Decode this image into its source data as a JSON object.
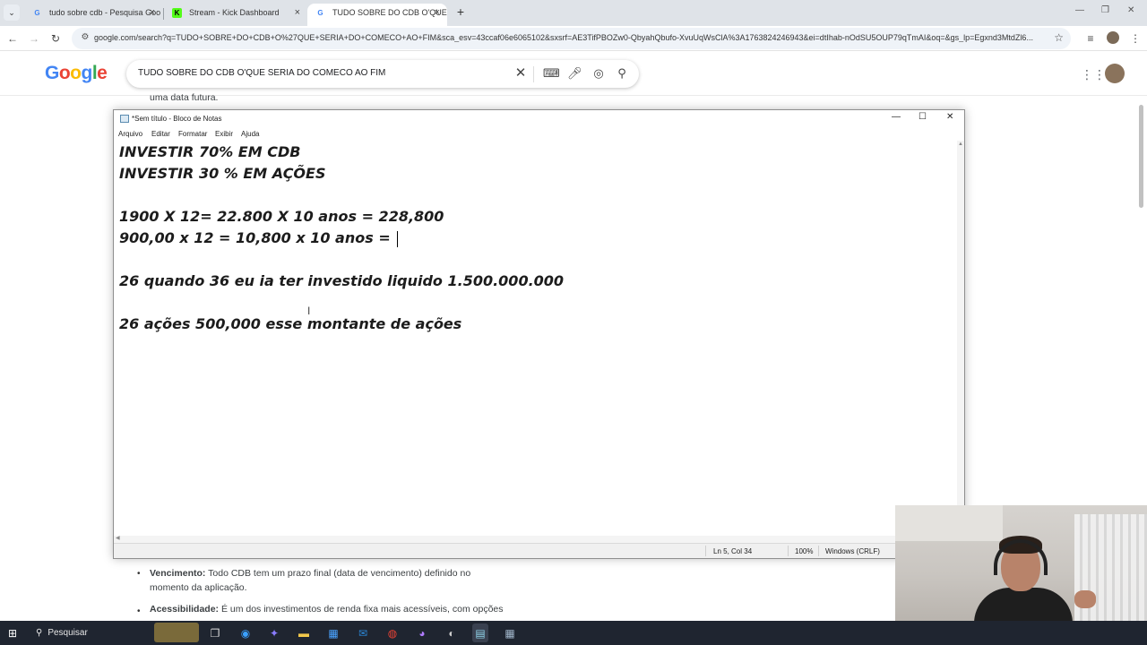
{
  "browser": {
    "tabs": [
      {
        "title": "tudo sobre cdb - Pesquisa Goo",
        "favicon": "google-icon",
        "active": false
      },
      {
        "title": "Stream - Kick Dashboard",
        "favicon": "kick-icon",
        "active": false
      },
      {
        "title": "TUDO SOBRE DO CDB O'QUE S",
        "favicon": "google-icon",
        "active": true
      }
    ],
    "new_tab": "+",
    "url": "google.com/search?q=TUDO+SOBRE+DO+CDB+O%27QUE+SERIA+DO+COMECO+AO+FIM&sca_esv=43ccaf06e6065102&sxsrf=AE3TifPBOZw0-QbyahQbufo-XvuUqWsClA%3A1763824246943&ei=dtIhab-nOdSU5OUP79qTmAI&oq=&gs_lp=Egxnd3MtdZl6..."
  },
  "google": {
    "logo": "Google",
    "query": "TUDO SOBRE DO CDB O'QUE SERIA DO COMECO AO FIM",
    "snippet_top": "uma data futura.",
    "bullets": [
      {
        "term": "Vencimento:",
        "text": " Todo CDB tem um prazo final (data de vencimento) definido no",
        "text2": "momento da aplicação."
      },
      {
        "term": "Acessibilidade:",
        "text": " É um dos investimentos de renda fixa mais acessíveis, com opções"
      }
    ]
  },
  "notepad": {
    "title": "*Sem título - Bloco de Notas",
    "menu": [
      "Arquivo",
      "Editar",
      "Formatar",
      "Exibir",
      "Ajuda"
    ],
    "lines": [
      "INVESTIR 70% EM CDB",
      "INVESTIR 30 % EM AÇÕES",
      "",
      "1900 X 12= 22.800 X 10 anos = 228,800",
      "900,00 x 12 = 10,800 x 10 anos = ",
      "",
      "26 quando 36 eu ia ter investido liquido 1.500.000.000",
      "",
      "26 ações 500,000 esse montante de ações"
    ],
    "status": {
      "position": "Ln 5, Col 34",
      "zoom": "100%",
      "line_ending": "Windows (CRLF)"
    }
  },
  "taskbar": {
    "search_label": "Pesquisar"
  }
}
